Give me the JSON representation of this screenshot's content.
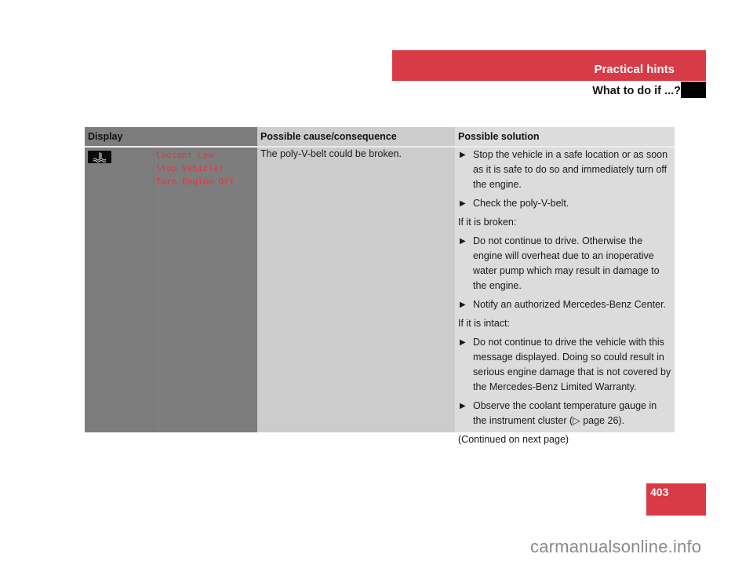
{
  "header": {
    "section_title": "Practical hints",
    "subtitle": "What to do if ...?",
    "accent_color": "#d83a46"
  },
  "table": {
    "headers": [
      "Display",
      "Possible cause/consequence",
      "Possible solution"
    ],
    "row": {
      "display_icon": "coolant-temperature-icon",
      "display_messages": [
        "Coolant Low",
        "Stop Vehicle!",
        "Turn Engine Off"
      ],
      "cause": "The poly-V-belt could be broken.",
      "solution": [
        {
          "type": "bullet",
          "text": "Stop the vehicle in a safe location or as soon as it is safe to do so and immediately turn off the engine."
        },
        {
          "type": "bullet",
          "text": "Check the poly-V-belt."
        },
        {
          "type": "plain",
          "text": "If it is broken:"
        },
        {
          "type": "bullet",
          "text": "Do not continue to drive. Otherwise the engine will overheat due to an inoperative water pump which may result in damage to the engine."
        },
        {
          "type": "bullet",
          "text": "Notify an authorized Mercedes-Benz Center."
        },
        {
          "type": "plain",
          "text": "If it is intact:"
        },
        {
          "type": "bullet",
          "text": "Do not continue to drive the vehicle with this message displayed. Doing so could result in serious engine damage that is not covered by the Mercedes-Benz Limited Warranty."
        },
        {
          "type": "bullet",
          "text": "Observe the coolant temperature gauge in the instrument cluster (▷ page 26)."
        },
        {
          "type": "plain",
          "text": "(Continued on next page)"
        }
      ]
    }
  },
  "page_number": "403",
  "watermark": "carmanualsonline.info"
}
